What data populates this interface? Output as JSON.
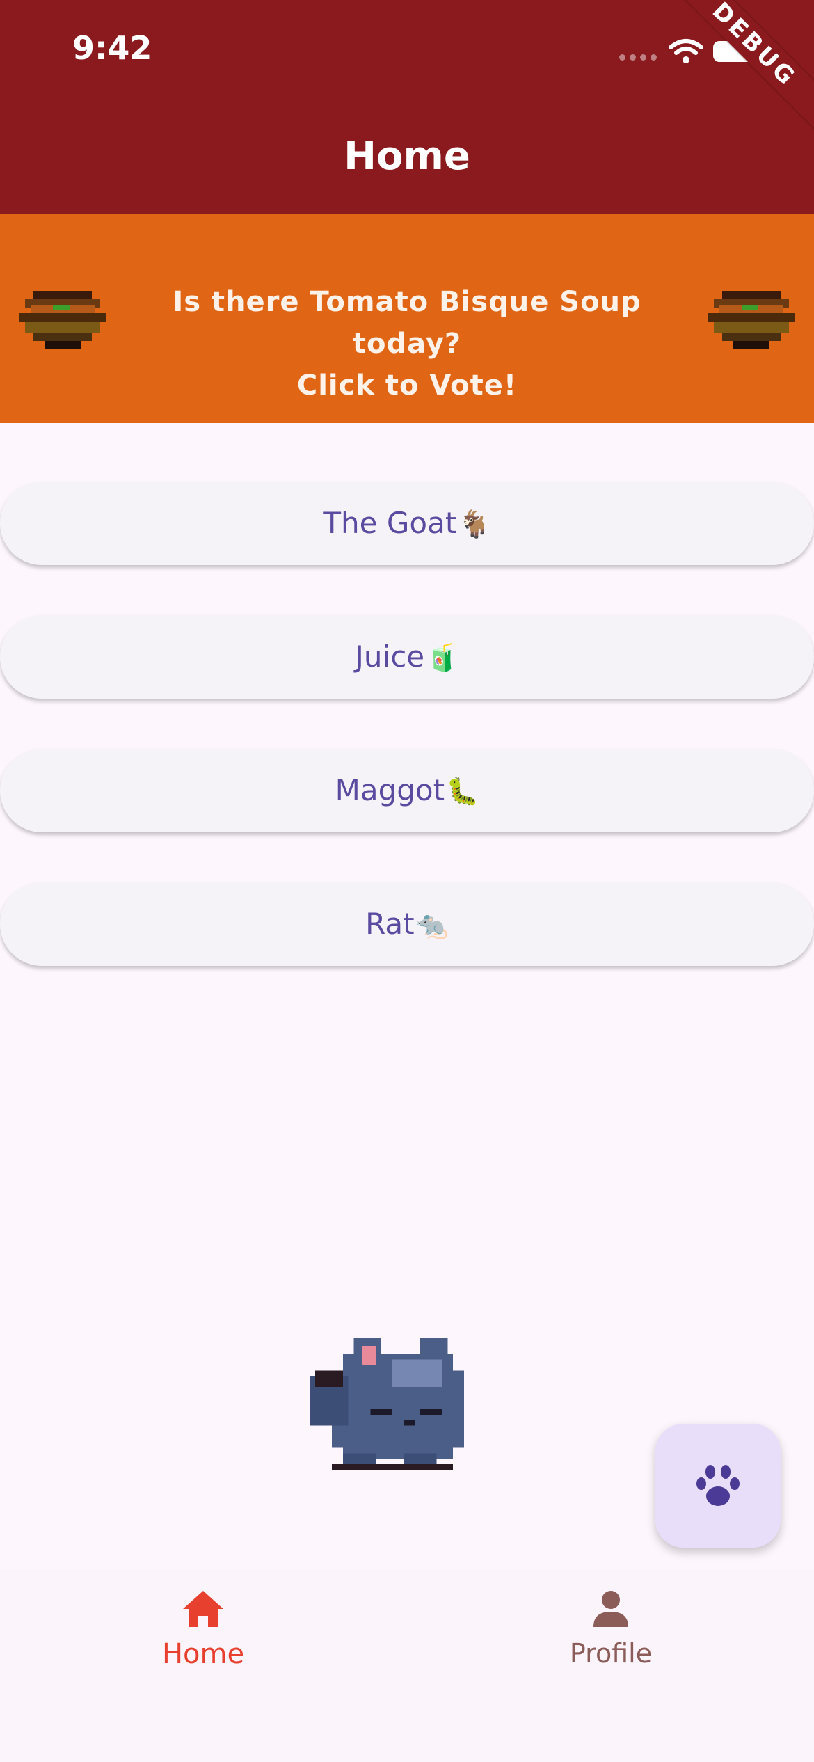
{
  "status_bar": {
    "time": "9:42",
    "icons": [
      "signal-dots-icon",
      "wifi-icon",
      "battery-icon"
    ]
  },
  "app_bar": {
    "title": "Home",
    "debug_ribbon": "DEBUG",
    "color": "#8a1a1e"
  },
  "banner": {
    "line1": "Is there Tomato Bisque Soup today?",
    "line2": "Click to Vote!",
    "icons": [
      "soup-bowl-icon",
      "soup-bowl-icon"
    ],
    "color": "#e06616"
  },
  "choices": [
    {
      "label": "The Goat",
      "emoji": "🐐"
    },
    {
      "label": "Juice",
      "emoji": "🧃"
    },
    {
      "label": "Maggot",
      "emoji": "🐛"
    },
    {
      "label": "Rat",
      "emoji": "🐀"
    }
  ],
  "mascot": {
    "icon": "sleeping-cat-icon"
  },
  "fab": {
    "icon": "paw-icon"
  },
  "bottom_nav": {
    "items": [
      {
        "label": "Home",
        "icon": "home-icon",
        "selected": true
      },
      {
        "label": "Profile",
        "icon": "person-icon",
        "selected": false
      }
    ]
  }
}
